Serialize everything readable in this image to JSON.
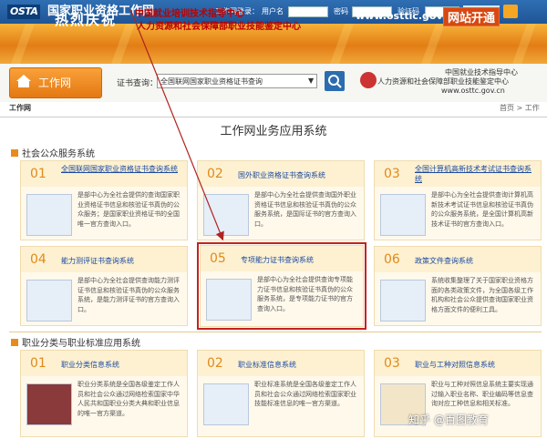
{
  "header": {
    "logo": "OSTA",
    "site_title": "国家职业资格工作网",
    "login_label": "工作网登录：",
    "user_label": "用户名",
    "pwd_label": "密码",
    "code_label": "验证码"
  },
  "banner": {
    "hot": "热烈庆祝",
    "line1": "中国就业培训技术指导中心",
    "line2": "人力资源和社会保障部职业技能鉴定中心",
    "url": "www.osttic.gov.cn",
    "open": "网站开通"
  },
  "nav": {
    "home_tab": "工作网",
    "search_label": "证书查询：",
    "search_select_value": "全国联网国家职业资格证书查询",
    "guide1": "中国就业技术指导中心",
    "guide2": "人力资源和社会保障部职业技能鉴定中心",
    "guide3": "www.osttc.gov.cn"
  },
  "breadcrumb": {
    "left": "工作网",
    "right": "首页 > 工作"
  },
  "page_title": "工作网业务应用系统",
  "sections": {
    "public": "社会公众服务系统",
    "classification": "职业分类与职业标准应用系统"
  },
  "cards": [
    {
      "num": "01",
      "title": "全国联网国家职业资格证书查询系统",
      "desc": "是部中心为全社会提供的查询国家职业资格证书信息和核验证书真伪的公众服务；是国家职业资格证书的全国唯一官方查询入口。"
    },
    {
      "num": "02",
      "title": "国外职业资格证书查询系统",
      "desc": "是部中心为全社会提供查询国外职业资格证书信息和核验证书真伪的公众服务系统，是国际证书的官方查询入口。"
    },
    {
      "num": "03",
      "title": "全国计算机高新技术考试证书查询系统",
      "desc": "是部中心为全社会提供查询计算机高新技术考试证书信息和核验证书真伪的公众服务系统，是全国计算机高新技术证书的官方查询入口。"
    },
    {
      "num": "04",
      "title": "能力测评证书查询系统",
      "desc": "是部中心为全社会提供查询能力测评证书信息和核验证书真伪的公众服务系统，是能力测评证书的官方查询入口。"
    },
    {
      "num": "05",
      "title": "专项能力证书查询系统",
      "desc": "是部中心为全社会提供查询专项能力证书信息和核验证书真伪的公众服务系统，是专项能力证书的官方查询入口。"
    },
    {
      "num": "06",
      "title": "政策文件查询系统",
      "desc": "系统收集整理了关于国家职业资格方面的各类政策文件，为全国各级工作机构和社会公众提供查询国家职业资格方面文件的便利工具。"
    },
    {
      "num": "01",
      "title": "职业分类信息系统",
      "desc": "职业分类系统是全国各级鉴定工作人员和社会公众通过网络检索国家中华人民共和国职业分类大典和职业信息的唯一官方渠道。"
    },
    {
      "num": "02",
      "title": "职业标准信息系统",
      "desc": "职业标准系统是全国各级鉴定工作人员和社会公众通过网络检索国家职业技能标准信息的唯一官方渠道。"
    },
    {
      "num": "03",
      "title": "职业与工种对照信息系统",
      "desc": "职业与工种对照信息系统主要实现通过输入职业名称、职业编码等信息查询对应工种信息和相关标准。"
    }
  ],
  "watermark": "知乎 @百图教育",
  "colors": {
    "accent": "#e88b1d",
    "link": "#1b4aa0",
    "highlight": "#c4221f",
    "header": "#2f6fb3"
  }
}
